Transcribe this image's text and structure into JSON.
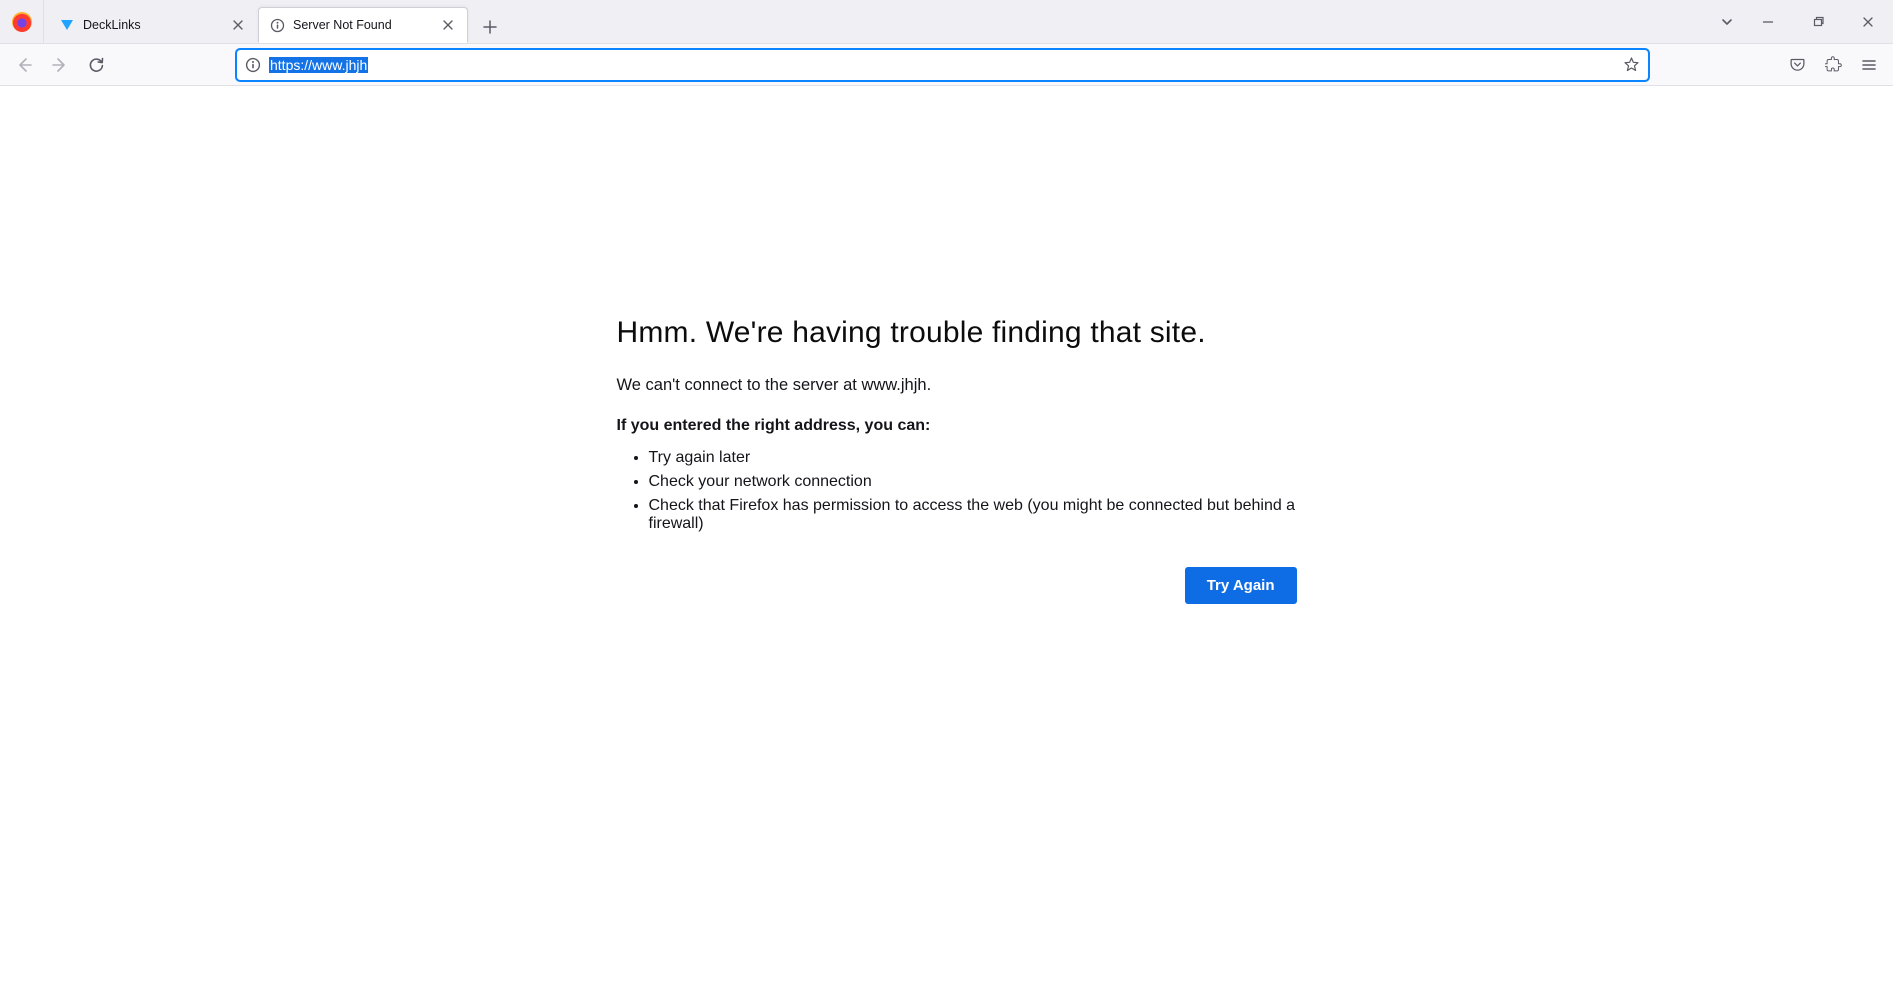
{
  "tabs": [
    {
      "title": "DeckLinks",
      "active": false
    },
    {
      "title": "Server Not Found",
      "active": true
    }
  ],
  "urlbar": {
    "url": "https://www.jhjh"
  },
  "error": {
    "heading": "Hmm. We're having trouble finding that site.",
    "subtext": "We can't connect to the server at www.jhjh.",
    "bold_line": "If you entered the right address, you can:",
    "bullets": [
      "Try again later",
      "Check your network connection",
      "Check that Firefox has permission to access the web (you might be connected but behind a firewall)"
    ],
    "button": "Try Again"
  }
}
